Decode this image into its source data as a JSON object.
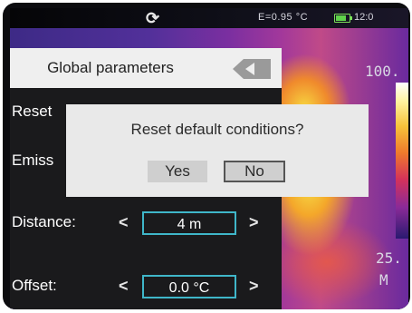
{
  "status_bar": {
    "refresh_icon": "refresh-icon",
    "emissivity_unit": "E=0.95  °C",
    "battery_icon": "battery-icon",
    "time": "12:0"
  },
  "header": {
    "title": "Global parameters",
    "back_icon": "back-arrow-icon"
  },
  "params": {
    "reset_label": "Reset",
    "emissivity_label": "Emiss",
    "distance_label": "Distance:",
    "distance_value": "4 m",
    "offset_label": "Offset:",
    "offset_value": "0.0 °C",
    "prev_glyph": "<",
    "next_glyph": ">"
  },
  "scale": {
    "max": "100.",
    "min": "25.",
    "mode": "M"
  },
  "dialog": {
    "message": "Reset default conditions?",
    "yes": "Yes",
    "no": "No"
  },
  "colors": {
    "accent_box": "#3fb6c9",
    "header_bg": "#efefef",
    "panel_bg": "#1a1a1c"
  }
}
